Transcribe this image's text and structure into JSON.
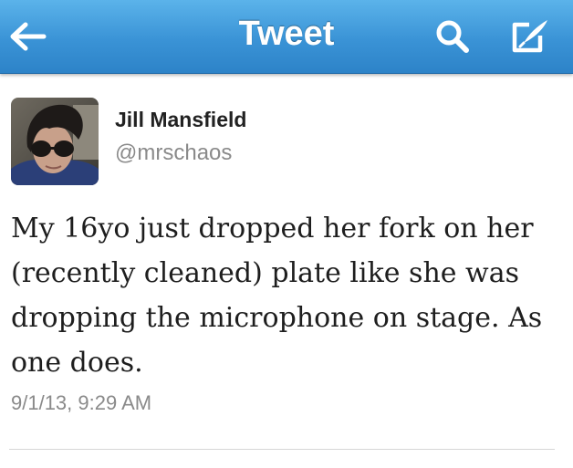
{
  "nav": {
    "title": "Tweet",
    "back_icon": "back-arrow-icon",
    "search_icon": "search-icon",
    "compose_icon": "compose-icon",
    "bar_color": "#3a93d6"
  },
  "tweet": {
    "author_name": "Jill Mansfield",
    "author_handle": "@mrschaos",
    "text": "My 16yo just dropped her fork on her (recently cleaned) plate like she was dropping the microphone on stage. As one does.",
    "timestamp": "9/1/13, 9:29 AM"
  }
}
